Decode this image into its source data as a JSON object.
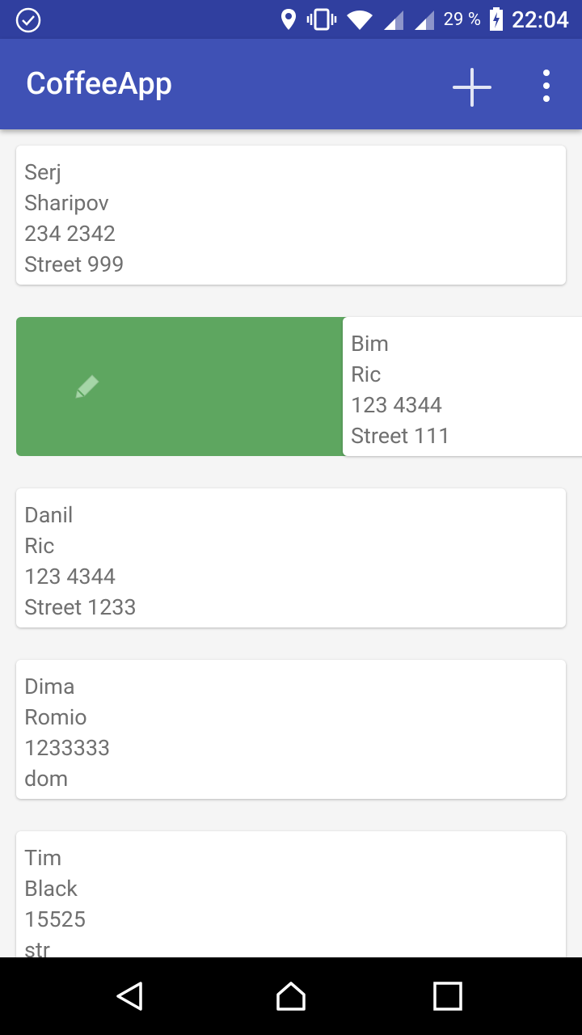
{
  "status_bar": {
    "battery_text": "29 %",
    "time": "22:04",
    "icons": [
      "check-circle-icon",
      "location-icon",
      "vibrate-icon",
      "wifi-icon",
      "signal-icon",
      "signal-icon",
      "battery-charging-icon"
    ]
  },
  "app_bar": {
    "title": "CoffeeApp",
    "actions": [
      "add-icon",
      "more-vert-icon"
    ]
  },
  "contacts": [
    {
      "first": "Serj",
      "last": "Sharipov",
      "phone": "234 2342",
      "address": "Street 999"
    },
    {
      "first": "Bim",
      "last": "Ric",
      "phone": "123 4344",
      "address": "Street 111",
      "swiped": true
    },
    {
      "first": "Danil",
      "last": "Ric",
      "phone": "123 4344",
      "address": "Street 1233"
    },
    {
      "first": "Dima",
      "last": "Romio",
      "phone": "1233333",
      "address": "dom"
    },
    {
      "first": "Tim",
      "last": "Black",
      "phone": "15525",
      "address": "str"
    }
  ],
  "swipe_action": {
    "icon": "edit-icon",
    "color": "#5ea660"
  },
  "colors": {
    "status_bar": "#303f9f",
    "app_bar": "#3f51b5",
    "text": "#707070"
  },
  "nav_bar": {
    "buttons": [
      "back-icon",
      "home-icon",
      "recents-icon"
    ]
  }
}
